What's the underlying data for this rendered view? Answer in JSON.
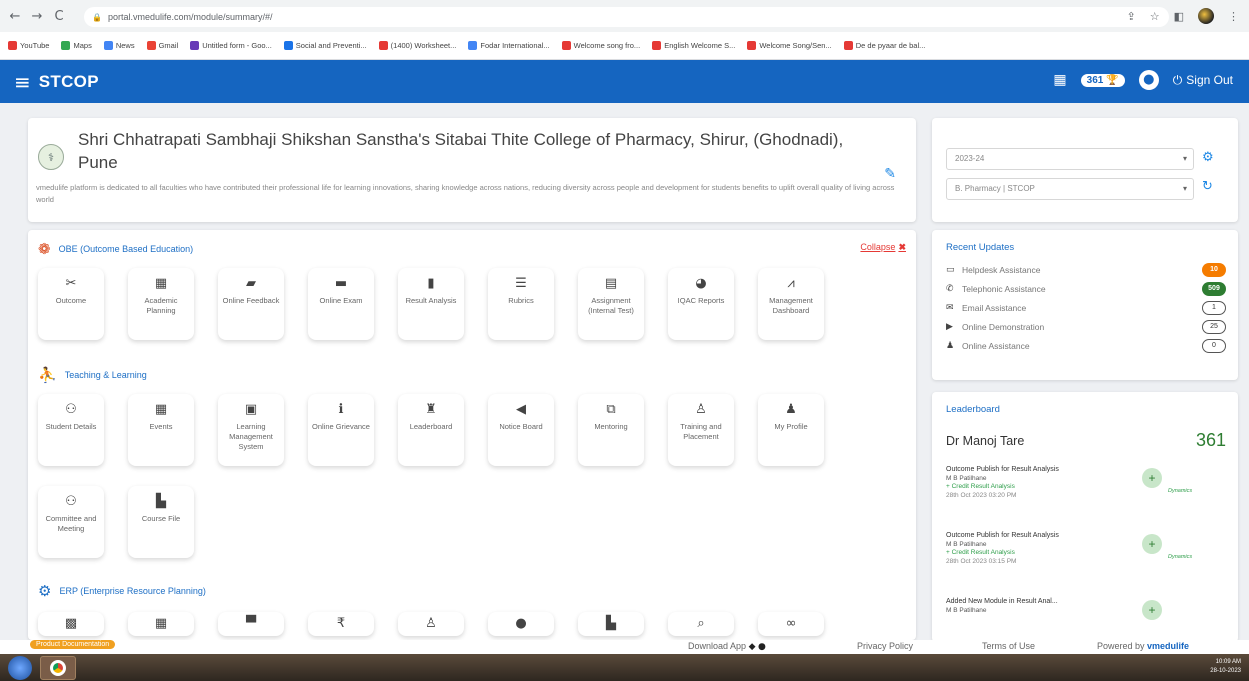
{
  "browser": {
    "url": "portal.vmedulife.com/module/summary/#/",
    "bookmarks": [
      {
        "label": "YouTube",
        "color": "#e53935"
      },
      {
        "label": "Maps",
        "color": "#34a853"
      },
      {
        "label": "News",
        "color": "#4285f4"
      },
      {
        "label": "Gmail",
        "color": "#ea4335"
      },
      {
        "label": "Untitled form - Goo...",
        "color": "#673ab7"
      },
      {
        "label": "Social and Preventi...",
        "color": "#1a73e8"
      },
      {
        "label": "(1400) Worksheet...",
        "color": "#e53935"
      },
      {
        "label": "Fodar International...",
        "color": "#4285f4"
      },
      {
        "label": "Welcome song fro...",
        "color": "#e53935"
      },
      {
        "label": "English Welcome S...",
        "color": "#e53935"
      },
      {
        "label": "Welcome Song/Sen...",
        "color": "#e53935"
      },
      {
        "label": "De de pyaar de bal...",
        "color": "#e53935"
      }
    ]
  },
  "header": {
    "title": "STCOP",
    "score": "361",
    "signout": "Sign Out"
  },
  "institute": {
    "name": "Shri Chhatrapati Sambhaji Shikshan Sanstha's Sitabai Thite College of Pharmacy, Shirur, (Ghodnadi), Pune",
    "description": "vmedulife platform is dedicated to all faculties who have contributed their professional life for learning innovations, sharing knowledge across nations, reducing diversity across people and development for students benefits to uplift overall quality of living across world"
  },
  "selectors": {
    "year": "2023-24",
    "program": "B. Pharmacy | STCOP"
  },
  "obe": {
    "title": "OBE (Outcome Based Education)",
    "collapse": "Collapse",
    "tiles": [
      {
        "label": "Outcome",
        "icon": "tools-icon"
      },
      {
        "label": "Academic Planning",
        "icon": "calendar-icon"
      },
      {
        "label": "Online Feedback",
        "icon": "comment-icon"
      },
      {
        "label": "Online Exam",
        "icon": "folder-icon"
      },
      {
        "label": "Result Analysis",
        "icon": "bar-chart-icon"
      },
      {
        "label": "Rubrics",
        "icon": "list-icon"
      },
      {
        "label": "Assignment (Internal Test)",
        "icon": "document-icon"
      },
      {
        "label": "IQAC Reports",
        "icon": "pie-chart-icon"
      },
      {
        "label": "Management Dashboard",
        "icon": "line-chart-icon"
      }
    ]
  },
  "teaching": {
    "title": "Teaching & Learning",
    "tiles": [
      {
        "label": "Student Details",
        "icon": "users-icon"
      },
      {
        "label": "Events",
        "icon": "calendar-icon"
      },
      {
        "label": "Learning Management System",
        "icon": "book-icon"
      },
      {
        "label": "Online Grievance",
        "icon": "info-icon"
      },
      {
        "label": "Leaderboard",
        "icon": "trophy-icon"
      },
      {
        "label": "Notice Board",
        "icon": "megaphone-icon"
      },
      {
        "label": "Mentoring",
        "icon": "presentation-icon"
      },
      {
        "label": "Training and Placement",
        "icon": "user-tie-icon"
      },
      {
        "label": "My Profile",
        "icon": "user-icon"
      },
      {
        "label": "Committee and Meeting",
        "icon": "users-icon"
      },
      {
        "label": "Course File",
        "icon": "file-icon"
      }
    ]
  },
  "erp": {
    "title": "ERP (Enterprise Resource Planning)",
    "tiles": [
      {
        "icon": "calculator-icon"
      },
      {
        "icon": "calendar-icon"
      },
      {
        "icon": "archive-icon"
      },
      {
        "icon": "rupee-icon"
      },
      {
        "icon": "user-plus-icon"
      },
      {
        "icon": "circle-icon"
      },
      {
        "icon": "file-icon"
      },
      {
        "icon": "chat-icon"
      },
      {
        "icon": "link-icon"
      }
    ]
  },
  "updates": {
    "title": "Recent Updates",
    "items": [
      {
        "label": "Helpdesk Assistance",
        "count": "10",
        "style": "orange",
        "icon": "monitor-icon"
      },
      {
        "label": "Telephonic Assistance",
        "count": "509",
        "style": "green",
        "icon": "phone-icon"
      },
      {
        "label": "Email Assistance",
        "count": "1",
        "style": "outline",
        "icon": "envelope-icon"
      },
      {
        "label": "Online Demonstration",
        "count": "25",
        "style": "outline",
        "icon": "video-icon"
      },
      {
        "label": "Online Assistance",
        "count": "0",
        "style": "outline",
        "icon": "user-icon"
      }
    ]
  },
  "leaderboard": {
    "title": "Leaderboard",
    "name": "Dr Manoj Tare",
    "score": "361",
    "activities": [
      {
        "title": "Outcome Publish for Result Analysis",
        "by": "M B Patilhane",
        "sub": "+ Credit Result Analysis",
        "date": "28th Oct 2023 03:20 PM",
        "tag": "Dynamics"
      },
      {
        "title": "Outcome Publish for Result Analysis",
        "by": "M B Patilhane",
        "sub": "+ Credit Result Analysis",
        "date": "28th Oct 2023 03:15 PM",
        "tag": "Dynamics"
      },
      {
        "title": "Added New Module in Result Anal...",
        "by": "M B Patilhane",
        "sub": "",
        "date": "",
        "tag": ""
      }
    ]
  },
  "footer": {
    "doc": "Product Documentation",
    "download": "Download App",
    "privacy": "Privacy Policy",
    "terms": "Terms of Use",
    "powered": "Powered by",
    "brand": "vmedulife"
  },
  "taskbar": {
    "time": "10:09 AM",
    "date": "28-10-2023"
  }
}
